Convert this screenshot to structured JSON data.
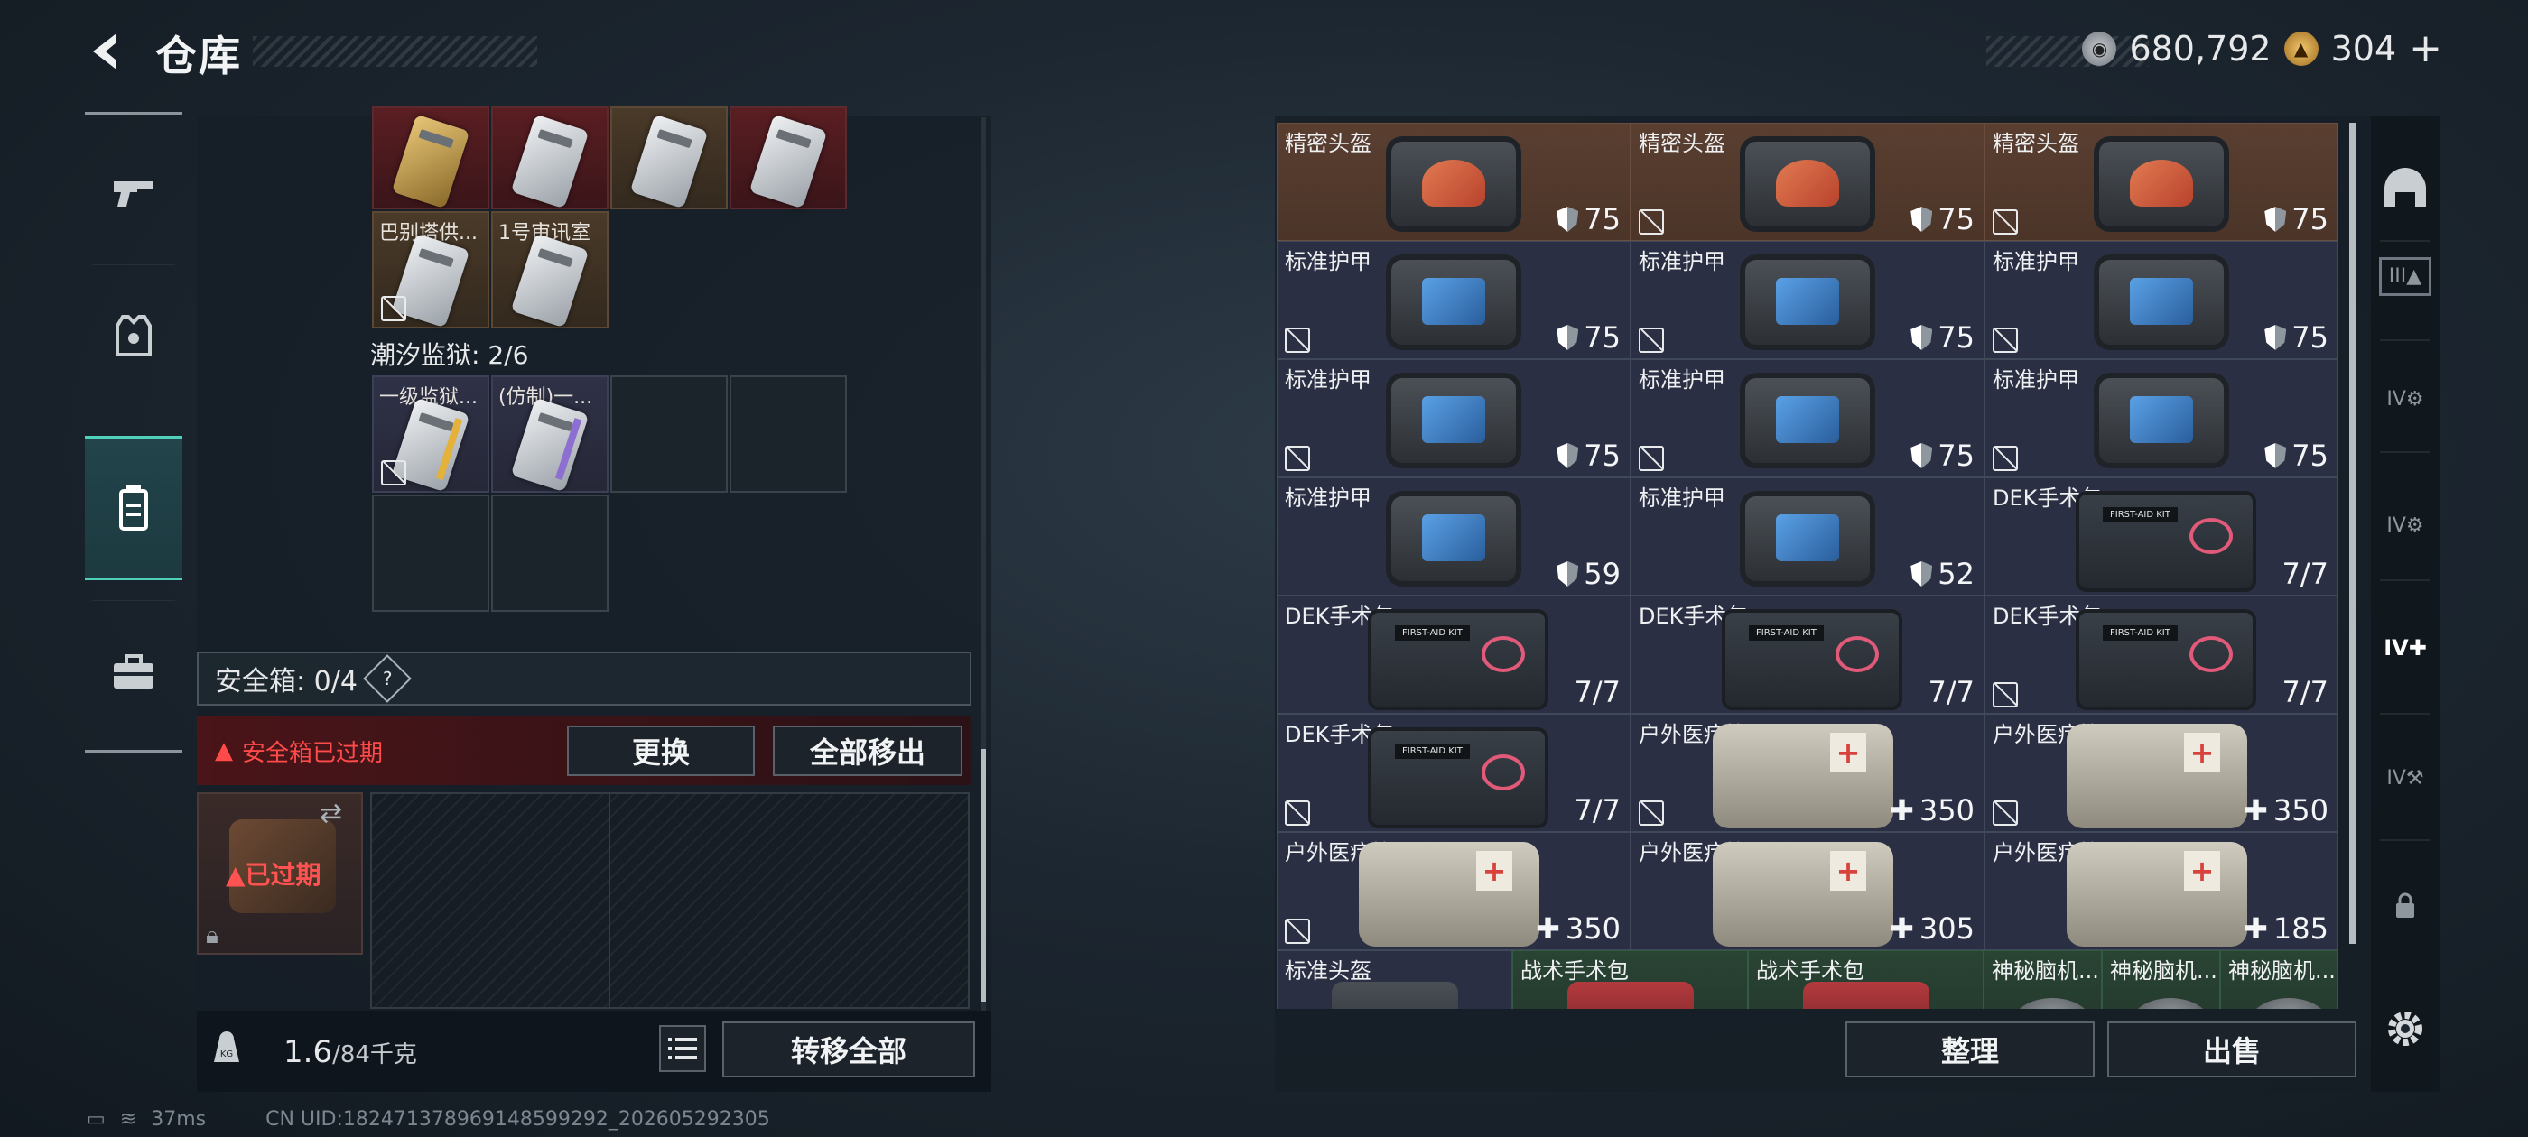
{
  "header": {
    "title": "仓库",
    "currency_a": "680,792",
    "currency_b": "304",
    "currency_b_plus": "+"
  },
  "keycards": {
    "row2": [
      {
        "label": "巴别塔供..."
      },
      {
        "label": "1号审讯室"
      }
    ],
    "prison_label": "潮汐监狱: 2/6",
    "row4": [
      {
        "label": "一级监狱..."
      },
      {
        "label": "(仿制)一..."
      }
    ]
  },
  "safebox": {
    "label": "安全箱: 0/4",
    "help": "?",
    "expired_message": "安全箱已过期",
    "swap_label": "更换",
    "move_all_label": "全部移出",
    "expired_tag": "已过期"
  },
  "weight": {
    "current": "1.6",
    "max": "/84千克",
    "transfer_all_label": "转移全部"
  },
  "stash": {
    "rows": [
      [
        {
          "label": "精密头盔",
          "value": "75"
        },
        {
          "label": "精密头盔",
          "value": "75"
        },
        {
          "label": "精密头盔",
          "value": "75"
        }
      ],
      [
        {
          "label": "标准护甲",
          "value": "75"
        },
        {
          "label": "标准护甲",
          "value": "75"
        },
        {
          "label": "标准护甲",
          "value": "75"
        }
      ],
      [
        {
          "label": "标准护甲",
          "value": "75"
        },
        {
          "label": "标准护甲",
          "value": "75"
        },
        {
          "label": "标准护甲",
          "value": "75"
        }
      ],
      [
        {
          "label": "标准护甲",
          "value": "59"
        },
        {
          "label": "标准护甲",
          "value": "52"
        },
        {
          "label": "DEK手术包",
          "value": "7/7"
        }
      ],
      [
        {
          "label": "DEK手术包",
          "value": "7/7"
        },
        {
          "label": "DEK手术包",
          "value": "7/7"
        },
        {
          "label": "DEK手术包",
          "value": "7/7"
        }
      ],
      [
        {
          "label": "DEK手术包",
          "value": "7/7"
        },
        {
          "label": "户外医疗箱",
          "value": "350"
        },
        {
          "label": "户外医疗箱",
          "value": "350"
        }
      ],
      [
        {
          "label": "户外医疗箱",
          "value": "350"
        },
        {
          "label": "户外医疗箱",
          "value": "305"
        },
        {
          "label": "户外医疗箱",
          "value": "185"
        }
      ],
      [
        {
          "label": "标准头盔"
        },
        {
          "label": "战术手术包"
        },
        {
          "label": "战术手术包"
        },
        {
          "label": "神秘脑机..."
        },
        {
          "label": "神秘脑机..."
        },
        {
          "label": "神秘脑机..."
        }
      ]
    ],
    "tidy_label": "整理",
    "sell_label": "出售"
  },
  "right_sidebar": {
    "tab_labels": [
      "III",
      "IV",
      "IV",
      "IV",
      "IV"
    ]
  },
  "status": {
    "ping": "37ms",
    "uid": "CN UID:182471378969148599292_202605292305"
  },
  "colors": {
    "accent": "#4fd1b9",
    "alert": "#ff4a4a",
    "helmet_bg": "#5a3f31",
    "armor_bg": "#2b2f44"
  }
}
